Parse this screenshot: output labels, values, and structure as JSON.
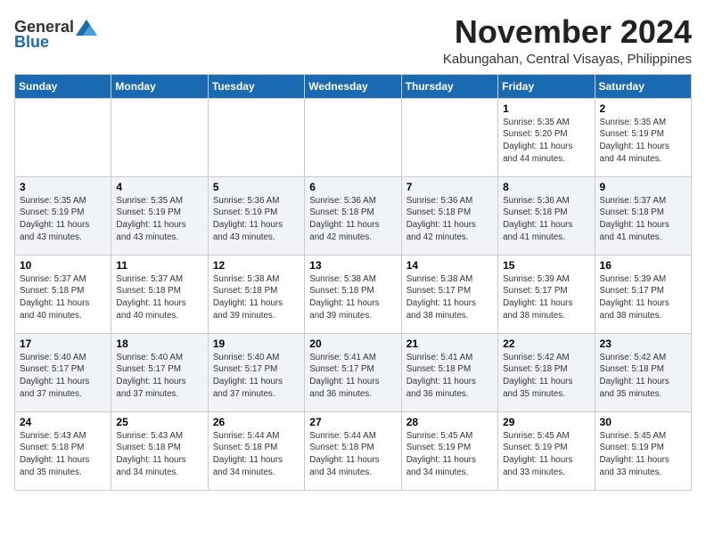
{
  "header": {
    "logo_general": "General",
    "logo_blue": "Blue",
    "month_title": "November 2024",
    "location": "Kabungahan, Central Visayas, Philippines"
  },
  "calendar": {
    "days_of_week": [
      "Sunday",
      "Monday",
      "Tuesday",
      "Wednesday",
      "Thursday",
      "Friday",
      "Saturday"
    ],
    "weeks": [
      [
        {
          "day": "",
          "info": ""
        },
        {
          "day": "",
          "info": ""
        },
        {
          "day": "",
          "info": ""
        },
        {
          "day": "",
          "info": ""
        },
        {
          "day": "",
          "info": ""
        },
        {
          "day": "1",
          "info": "Sunrise: 5:35 AM\nSunset: 5:20 PM\nDaylight: 11 hours\nand 44 minutes."
        },
        {
          "day": "2",
          "info": "Sunrise: 5:35 AM\nSunset: 5:19 PM\nDaylight: 11 hours\nand 44 minutes."
        }
      ],
      [
        {
          "day": "3",
          "info": "Sunrise: 5:35 AM\nSunset: 5:19 PM\nDaylight: 11 hours\nand 43 minutes."
        },
        {
          "day": "4",
          "info": "Sunrise: 5:35 AM\nSunset: 5:19 PM\nDaylight: 11 hours\nand 43 minutes."
        },
        {
          "day": "5",
          "info": "Sunrise: 5:36 AM\nSunset: 5:19 PM\nDaylight: 11 hours\nand 43 minutes."
        },
        {
          "day": "6",
          "info": "Sunrise: 5:36 AM\nSunset: 5:18 PM\nDaylight: 11 hours\nand 42 minutes."
        },
        {
          "day": "7",
          "info": "Sunrise: 5:36 AM\nSunset: 5:18 PM\nDaylight: 11 hours\nand 42 minutes."
        },
        {
          "day": "8",
          "info": "Sunrise: 5:36 AM\nSunset: 5:18 PM\nDaylight: 11 hours\nand 41 minutes."
        },
        {
          "day": "9",
          "info": "Sunrise: 5:37 AM\nSunset: 5:18 PM\nDaylight: 11 hours\nand 41 minutes."
        }
      ],
      [
        {
          "day": "10",
          "info": "Sunrise: 5:37 AM\nSunset: 5:18 PM\nDaylight: 11 hours\nand 40 minutes."
        },
        {
          "day": "11",
          "info": "Sunrise: 5:37 AM\nSunset: 5:18 PM\nDaylight: 11 hours\nand 40 minutes."
        },
        {
          "day": "12",
          "info": "Sunrise: 5:38 AM\nSunset: 5:18 PM\nDaylight: 11 hours\nand 39 minutes."
        },
        {
          "day": "13",
          "info": "Sunrise: 5:38 AM\nSunset: 5:18 PM\nDaylight: 11 hours\nand 39 minutes."
        },
        {
          "day": "14",
          "info": "Sunrise: 5:38 AM\nSunset: 5:17 PM\nDaylight: 11 hours\nand 38 minutes."
        },
        {
          "day": "15",
          "info": "Sunrise: 5:39 AM\nSunset: 5:17 PM\nDaylight: 11 hours\nand 38 minutes."
        },
        {
          "day": "16",
          "info": "Sunrise: 5:39 AM\nSunset: 5:17 PM\nDaylight: 11 hours\nand 38 minutes."
        }
      ],
      [
        {
          "day": "17",
          "info": "Sunrise: 5:40 AM\nSunset: 5:17 PM\nDaylight: 11 hours\nand 37 minutes."
        },
        {
          "day": "18",
          "info": "Sunrise: 5:40 AM\nSunset: 5:17 PM\nDaylight: 11 hours\nand 37 minutes."
        },
        {
          "day": "19",
          "info": "Sunrise: 5:40 AM\nSunset: 5:17 PM\nDaylight: 11 hours\nand 37 minutes."
        },
        {
          "day": "20",
          "info": "Sunrise: 5:41 AM\nSunset: 5:17 PM\nDaylight: 11 hours\nand 36 minutes."
        },
        {
          "day": "21",
          "info": "Sunrise: 5:41 AM\nSunset: 5:18 PM\nDaylight: 11 hours\nand 36 minutes."
        },
        {
          "day": "22",
          "info": "Sunrise: 5:42 AM\nSunset: 5:18 PM\nDaylight: 11 hours\nand 35 minutes."
        },
        {
          "day": "23",
          "info": "Sunrise: 5:42 AM\nSunset: 5:18 PM\nDaylight: 11 hours\nand 35 minutes."
        }
      ],
      [
        {
          "day": "24",
          "info": "Sunrise: 5:43 AM\nSunset: 5:18 PM\nDaylight: 11 hours\nand 35 minutes."
        },
        {
          "day": "25",
          "info": "Sunrise: 5:43 AM\nSunset: 5:18 PM\nDaylight: 11 hours\nand 34 minutes."
        },
        {
          "day": "26",
          "info": "Sunrise: 5:44 AM\nSunset: 5:18 PM\nDaylight: 11 hours\nand 34 minutes."
        },
        {
          "day": "27",
          "info": "Sunrise: 5:44 AM\nSunset: 5:18 PM\nDaylight: 11 hours\nand 34 minutes."
        },
        {
          "day": "28",
          "info": "Sunrise: 5:45 AM\nSunset: 5:19 PM\nDaylight: 11 hours\nand 34 minutes."
        },
        {
          "day": "29",
          "info": "Sunrise: 5:45 AM\nSunset: 5:19 PM\nDaylight: 11 hours\nand 33 minutes."
        },
        {
          "day": "30",
          "info": "Sunrise: 5:45 AM\nSunset: 5:19 PM\nDaylight: 11 hours\nand 33 minutes."
        }
      ]
    ]
  }
}
